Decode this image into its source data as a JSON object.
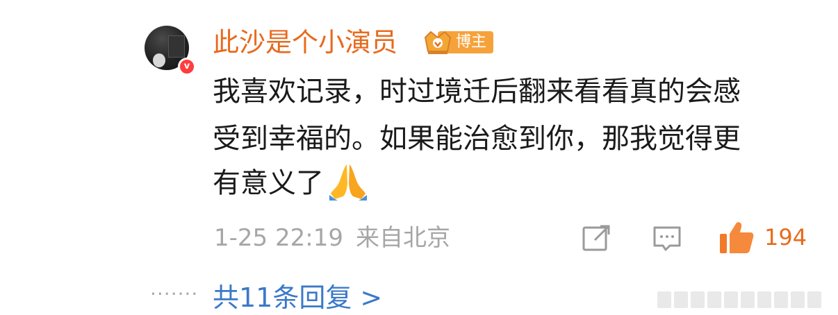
{
  "comment": {
    "author": "此沙是个小演员",
    "author_tag": "博主",
    "verified_badge": "v",
    "text_lines": [
      "我喜欢记录，时过境迁后翻来看看真的会感",
      "受到幸福的。如果能治愈到你，那我觉得更",
      "有意义了"
    ],
    "date": "1-25 22:19",
    "location": "来自北京",
    "likes": "194",
    "replies_label": "共11条回复 >",
    "dots": "·······"
  },
  "colors": {
    "author": "#e86a1c",
    "tag": "#f6a23a",
    "link": "#3a79c9",
    "meta": "#a6a6a6"
  },
  "icons": [
    "avatar",
    "verified-v-icon",
    "crown-icon",
    "folded-hands-emoji",
    "share-icon",
    "comment-icon",
    "thumbs-up-icon"
  ]
}
